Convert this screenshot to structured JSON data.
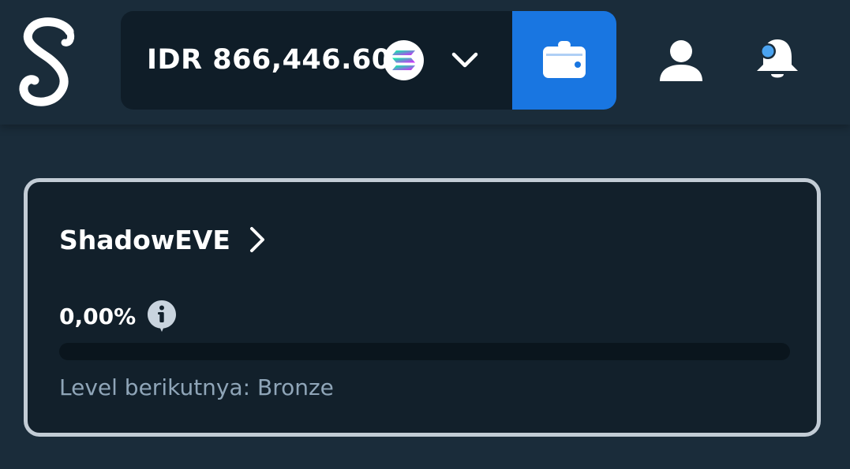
{
  "header": {
    "logo_glyph": "S",
    "balance": "IDR 866,446.60",
    "currency_icon": "solana-icon",
    "dropdown_icon": "chevron-down-icon",
    "wallet_icon": "wallet-icon",
    "profile_icon": "user-icon",
    "notifications_icon": "bell-icon"
  },
  "level_card": {
    "username": "ShadowEVE",
    "progress_label": "0,00%",
    "progress_value": 0,
    "next_level_text": "Level berikutnya: Bronze"
  },
  "colors": {
    "background": "#1a2c3a",
    "pill": "#0f1d28",
    "accent_blue": "#1976e1",
    "card_border": "#c2ccd5",
    "muted_text": "#8fa5b8"
  }
}
